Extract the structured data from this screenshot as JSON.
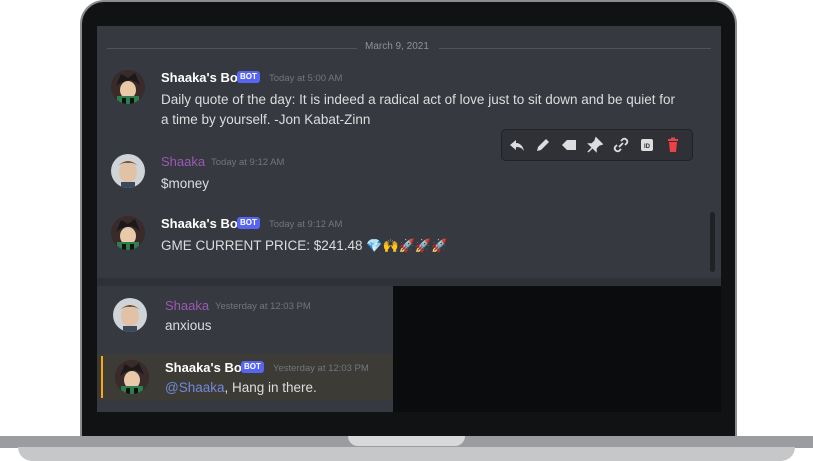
{
  "divider": {
    "date": "March 9, 2021"
  },
  "messages": [
    {
      "author": "Shaaka's Bot",
      "bot_tag": "BOT",
      "timestamp": "Today at 5:00 AM",
      "lines": [
        "Daily quote of the day: It is indeed a radical act of love just to sit down and be quiet for",
        "a time by yourself. -Jon Kabat-Zinn"
      ]
    },
    {
      "author": "Shaaka",
      "timestamp": "Today at 9:12 AM",
      "lines": [
        "$money"
      ]
    },
    {
      "author": "Shaaka's Bot",
      "bot_tag": "BOT",
      "timestamp": "Today at 9:12 AM",
      "lines": [
        "GME CURRENT PRICE: $241.48"
      ],
      "emoji": "💎🙌🚀🚀🚀"
    },
    {
      "author": "Shaaka",
      "timestamp": "Yesterday at 12:03 PM",
      "lines": [
        "anxious"
      ]
    },
    {
      "author": "Shaaka's Bot",
      "bot_tag": "BOT",
      "timestamp": "Yesterday at 12:03 PM",
      "mention": "@Shaaka",
      "text": ", Hang in there."
    }
  ],
  "toolbar": {
    "icons": [
      "reply-icon",
      "edit-icon",
      "mark-unread-icon",
      "pin-icon",
      "copy-link-icon",
      "copy-id-icon",
      "delete-icon"
    ],
    "id_label": "ID"
  },
  "colors": {
    "background": "#36393f",
    "username_purple": "#9b59b6",
    "bot_badge": "#5865f2",
    "mention": "#7289da",
    "highlight_bar": "#faa61a",
    "delete": "#ed4245"
  }
}
